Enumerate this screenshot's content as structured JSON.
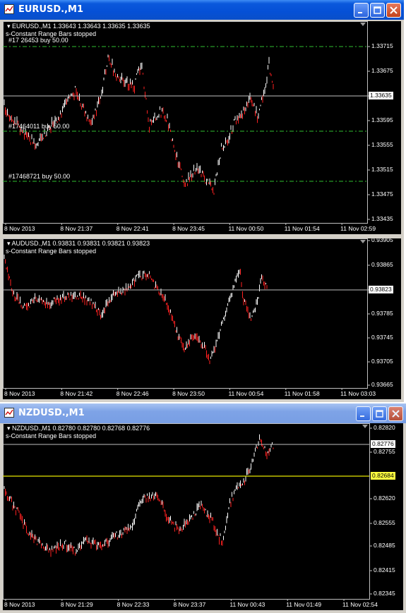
{
  "colors": {
    "grid_line": "#c0c0c0",
    "order_line": "#2fbf2f",
    "bid_line": "#c0c0c0",
    "alert_line": "#e6e600",
    "bull": "#ffffff",
    "bear": "#ff2020"
  },
  "windows": [
    {
      "title": "EURUSD.,M1",
      "ohlc": "EURUSD.,M1  1.33643 1.33643 1.33635 1.33635",
      "indicator": "s-Constant Range Bars stopped",
      "orders": [
        {
          "label": "#17 26453 buy 50.00",
          "price": 1.33715
        },
        {
          "label": "#17464011 buy 50.00",
          "price": 1.33585
        },
        {
          "label": "#17468721 buy 50.00",
          "price": 1.335
        }
      ],
      "current_price": "1.33635",
      "price_ticks": [
        "1.33715",
        "1.33675",
        "1.33635",
        "1.33595",
        "1.33555",
        "1.33515",
        "1.33475",
        "1.33435"
      ],
      "time_ticks": [
        "8 Nov 2013",
        "8 Nov 21:37",
        "8 Nov 22:41",
        "8 Nov 23:45",
        "11 Nov 00:50",
        "11 Nov 01:54",
        "11 Nov 02:59"
      ]
    },
    {
      "title": "AUDUSD.,M1",
      "ohlc": "AUDUSD.,M1  0.93831 0.93831 0.93821 0.93823",
      "indicator": "s-Constant Range Bars stopped",
      "current_price": "0.93823",
      "price_ticks": [
        "0.93905",
        "0.93865",
        "0.93825",
        "0.93785",
        "0.93745",
        "0.93705",
        "0.93665"
      ],
      "time_ticks": [
        "8 Nov 2013",
        "8 Nov 21:42",
        "8 Nov 22:46",
        "8 Nov 23:50",
        "11 Nov 00:54",
        "11 Nov 01:58",
        "11 Nov 03:03"
      ]
    },
    {
      "title": "NZDUSD.,M1",
      "ohlc": "NZDUSD.,M1  0.82780 0.82780 0.82768 0.82776",
      "indicator": "s-Constant Range Bars stopped",
      "current_price": "0.82776",
      "alert_price": "0.82684",
      "price_ticks": [
        "0.82820",
        "0.82755",
        "0.82620",
        "0.82555",
        "0.82485",
        "0.82415",
        "0.82345"
      ],
      "time_ticks": [
        "8 Nov 2013",
        "8 Nov 21:29",
        "8 Nov 22:33",
        "8 Nov 23:37",
        "11 Nov 00:43",
        "11 Nov 01:49",
        "11 Nov 02:54"
      ]
    }
  ]
}
